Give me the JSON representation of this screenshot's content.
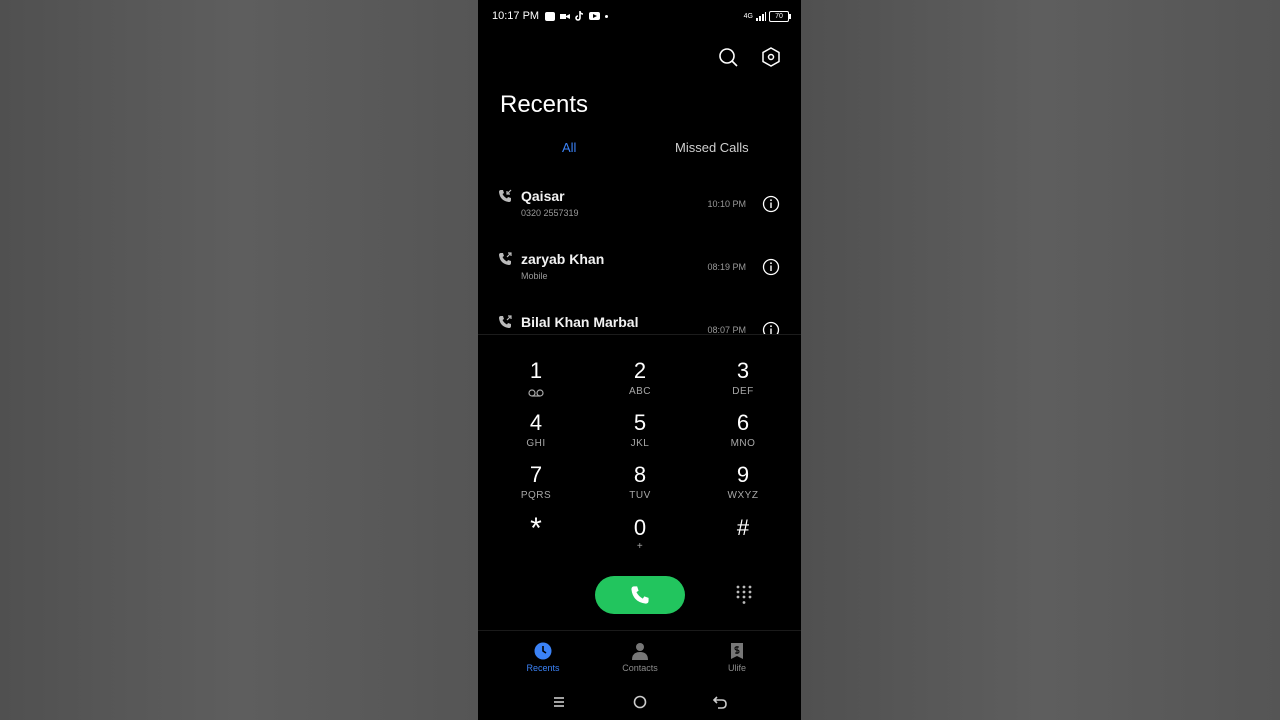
{
  "status_bar": {
    "time": "10:17 PM",
    "network": "4G",
    "battery": "70"
  },
  "header": {
    "title": "Recents"
  },
  "tabs": [
    {
      "label": "All",
      "active": true
    },
    {
      "label": "Missed Calls",
      "active": false
    }
  ],
  "calls": [
    {
      "name": "Qaisar",
      "sub": "0320 2557319",
      "time": "10:10 PM",
      "type": "incoming-call-icon"
    },
    {
      "name": "zaryab Khan",
      "sub": "Mobile",
      "time": "08:19 PM",
      "type": "outgoing-call-icon"
    },
    {
      "name": "Bilal Khan Marbal",
      "sub": "",
      "time": "08:07 PM",
      "type": "outgoing-call-icon"
    }
  ],
  "keypad": [
    {
      "digit": "1",
      "letters": ""
    },
    {
      "digit": "2",
      "letters": "ABC"
    },
    {
      "digit": "3",
      "letters": "DEF"
    },
    {
      "digit": "4",
      "letters": "GHI"
    },
    {
      "digit": "5",
      "letters": "JKL"
    },
    {
      "digit": "6",
      "letters": "MNO"
    },
    {
      "digit": "7",
      "letters": "PQRS"
    },
    {
      "digit": "8",
      "letters": "TUV"
    },
    {
      "digit": "9",
      "letters": "WXYZ"
    },
    {
      "digit": "*",
      "letters": ""
    },
    {
      "digit": "0",
      "letters": "+"
    },
    {
      "digit": "#",
      "letters": ""
    }
  ],
  "bottom_nav": [
    {
      "label": "Recents",
      "icon": "clock-icon",
      "active": true
    },
    {
      "label": "Contacts",
      "icon": "person-icon",
      "active": false
    },
    {
      "label": "Ulife",
      "icon": "ulife-icon",
      "active": false
    }
  ],
  "colors": {
    "accent": "#3b82f6",
    "call_button": "#22c55e",
    "background": "#000000"
  }
}
